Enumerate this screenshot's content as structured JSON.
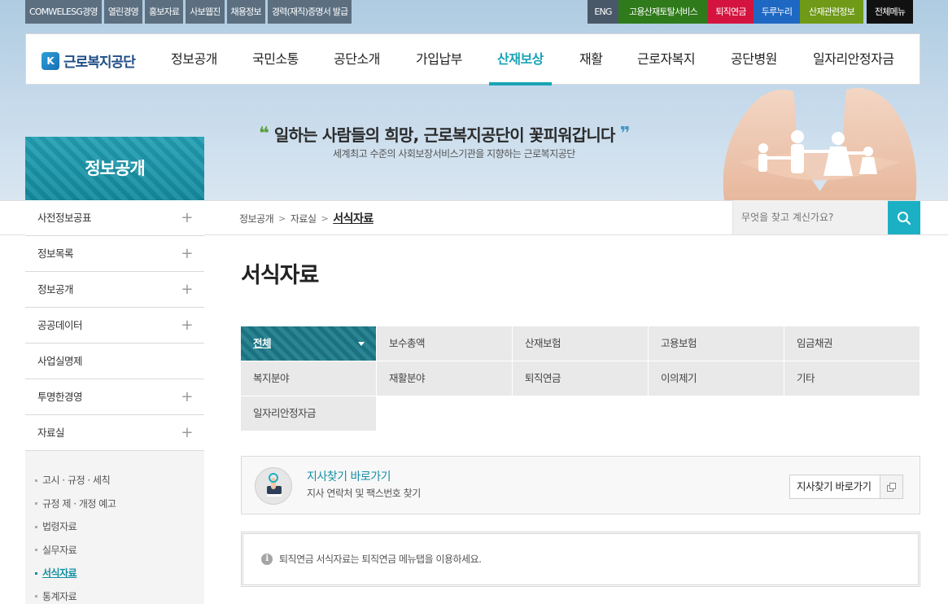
{
  "topbar": {
    "left_links": [
      "COMWELESG경영",
      "열린경영",
      "홍보자료",
      "사보웹진",
      "채용정보",
      "경력(재직)증명서 발급"
    ],
    "right_links": [
      {
        "label": "ENG",
        "color": "#495868"
      },
      {
        "label": "고용산재토탈서비스",
        "color": "#2f7a1b"
      },
      {
        "label": "퇴직연금",
        "color": "#d4143f"
      },
      {
        "label": "두루누리",
        "color": "#1e68c3"
      },
      {
        "label": "산재관련정보",
        "color": "#6f9a18"
      }
    ],
    "all_menu": "전체메뉴"
  },
  "logo": {
    "mark": "K",
    "text": "근로복지공단"
  },
  "gnb": {
    "items": [
      "정보공개",
      "국민소통",
      "공단소개",
      "가입납부",
      "산재보상",
      "재활",
      "근로자복지",
      "공단병원",
      "일자리안정자금"
    ],
    "active": "산재보상",
    "accent": "#1aa3b5"
  },
  "hero": {
    "slogan": "일하는 사람들의 희망, 근로복지공단이 꽃피워갑니다",
    "sub": "세계최고 수준의 사회보장서비스기관을 지향하는 근로복지공단"
  },
  "lnb": {
    "title": "정보공개",
    "items": [
      {
        "label": "사전정보공표",
        "expand": "+"
      },
      {
        "label": "정보목록",
        "expand": "+"
      },
      {
        "label": "정보공개",
        "expand": "+"
      },
      {
        "label": "공공데이터",
        "expand": "+"
      },
      {
        "label": "사업실명제",
        "expand": ""
      },
      {
        "label": "투명한경영",
        "expand": "+"
      },
      {
        "label": "자료실",
        "expand": "+"
      }
    ],
    "sub_items": [
      "고시 · 규정 · 세칙",
      "규정 제 · 개정 예고",
      "법령자료",
      "실무자료",
      "서식자료",
      "통계자료"
    ],
    "active_sub": "서식자료"
  },
  "breadcrumb": {
    "items": [
      "정보공개",
      "자료실"
    ],
    "separator": ">",
    "current": "서식자료"
  },
  "search": {
    "placeholder": "무엇을 찾고 계신가요?"
  },
  "content": {
    "title": "서식자료",
    "categories": [
      "전체",
      "보수총액",
      "산재보험",
      "고용보험",
      "임금채권",
      "복지분야",
      "재활분야",
      "퇴직연금",
      "이의제기",
      "기타",
      "일자리안정자금"
    ],
    "active_category": "전체",
    "branch": {
      "title": "지사찾기 바로가기",
      "desc": "지사 연락처 및 팩스번호 찾기",
      "button": "지사찾기 바로가기"
    },
    "notice": {
      "icon": "i",
      "text": "퇴직연금 서식자료는 퇴직연금 메뉴탭을 이용하세요."
    }
  }
}
